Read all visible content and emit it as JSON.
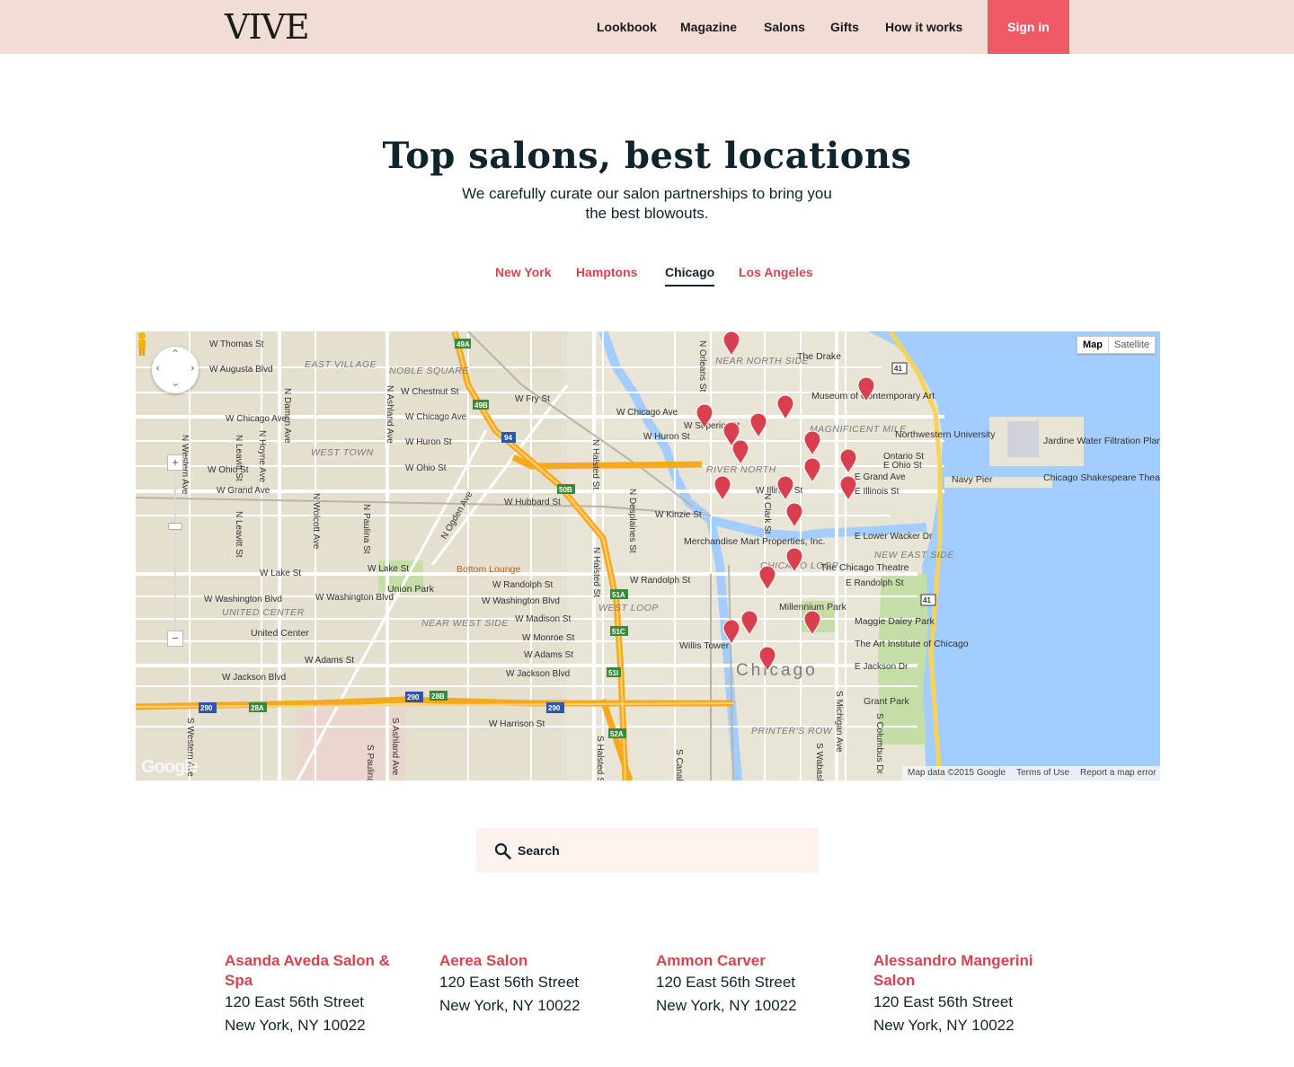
{
  "header": {
    "logo": "VIVE",
    "nav": [
      "Lookbook",
      "Magazine",
      "Salons",
      "Gifts",
      "How it works"
    ],
    "signin_label": "Sign in"
  },
  "hero": {
    "title": "Top salons, best locations",
    "subtitle": "We carefully curate our salon partnerships to bring you the best blowouts."
  },
  "tabs": [
    {
      "label": "New York",
      "active": false
    },
    {
      "label": "Hamptons",
      "active": false
    },
    {
      "label": "Chicago",
      "active": true
    },
    {
      "label": "Los Angeles",
      "active": false
    }
  ],
  "map": {
    "type_options": [
      "Map",
      "Satellite"
    ],
    "selected_type": "Map",
    "city_label": "Chicago",
    "attribution": [
      "Map data ©2015 Google",
      "Terms of Use",
      "Report a map error"
    ],
    "logo_text": "Google",
    "zoom_in": "+",
    "zoom_out": "−",
    "labels": {
      "streets": [
        "W Thomas St",
        "W Augusta Blvd",
        "W Chestnut St",
        "W Chicago Ave",
        "W Huron St",
        "W Ohio St",
        "W Grand Ave",
        "W Hubbard St",
        "W Kinzie St",
        "W Lake St",
        "W Randolph St",
        "W Washington Blvd",
        "W Madison St",
        "W Monroe St",
        "W Adams St",
        "W Jackson Blvd",
        "W Harrison St",
        "W Fry St",
        "W Superior St",
        "E Ohio St",
        "E Grand Ave",
        "E Lower Wacker Dr",
        "E Randolph St",
        "E Jackson Dr",
        "N Damen Ave",
        "N Ashland Ave",
        "N Halsted St",
        "N Orleans St",
        "N Clark St",
        "S Michigan Ave",
        "N Desplaines St",
        "N Leavitt St",
        "N Hoyne Ave",
        "N Western Ave",
        "N Wolcott Ave",
        "N Paulina St",
        "N Ogden Ave",
        "S Western Ave",
        "S Ashland Ave",
        "S Halsted St",
        "S Columbus Dr",
        "S Wabash",
        "S Canal",
        "Ontario St",
        "W Illinois St",
        "E Illinois St",
        "S Paulina St"
      ],
      "areas": [
        "EAST VILLAGE",
        "NOBLE SQUARE",
        "WEST TOWN",
        "UNITED CENTER",
        "NEAR WEST SIDE",
        "WEST LOOP",
        "NEAR NORTH SIDE",
        "MAGNIFICENT MILE",
        "RIVER NORTH",
        "CHICAGO LOOP",
        "NEW EAST SIDE",
        "PRINTER'S ROW"
      ],
      "places": [
        "The Drake",
        "Museum of Contemporary Art",
        "Northwestern University",
        "Jardine Water Filtration Plant",
        "Navy Pier",
        "Chicago Shakespeare Theater",
        "Merchandise Mart Properties, Inc.",
        "The Chicago Theatre",
        "Millennium Park",
        "Maggie Daley Park",
        "The Art Institute of Chicago",
        "Grant Park",
        "Willis Tower",
        "United Center",
        "Union Park",
        "Bottom Lounge"
      ],
      "highways": [
        "90",
        "94",
        "290",
        "41",
        "49A",
        "49B",
        "50B",
        "51A",
        "51C",
        "51I",
        "52A",
        "28A",
        "28B"
      ]
    }
  },
  "search": {
    "placeholder": "Search"
  },
  "salons": [
    {
      "name": "Asanda Aveda Salon & Spa",
      "street": "120 East 56th Street",
      "city": "New York, NY 10022"
    },
    {
      "name": "Aerea Salon",
      "street": "120 East 56th Street",
      "city": "New York, NY 10022"
    },
    {
      "name": "Ammon Carver",
      "street": "120 East 56th Street",
      "city": "New York, NY 10022"
    },
    {
      "name": "Alessandro Mangerini Salon",
      "street": "120 East 56th Street",
      "city": "New York, NY 10022"
    }
  ],
  "colors": {
    "header_bg": "#f1ddd5",
    "accent": "#f05a67",
    "link": "#d5434f",
    "text": "#10242c",
    "search_bg": "#fdf2ee",
    "marker": "#d9404f",
    "water": "#a3ccff",
    "highway": "#f7a91e"
  }
}
